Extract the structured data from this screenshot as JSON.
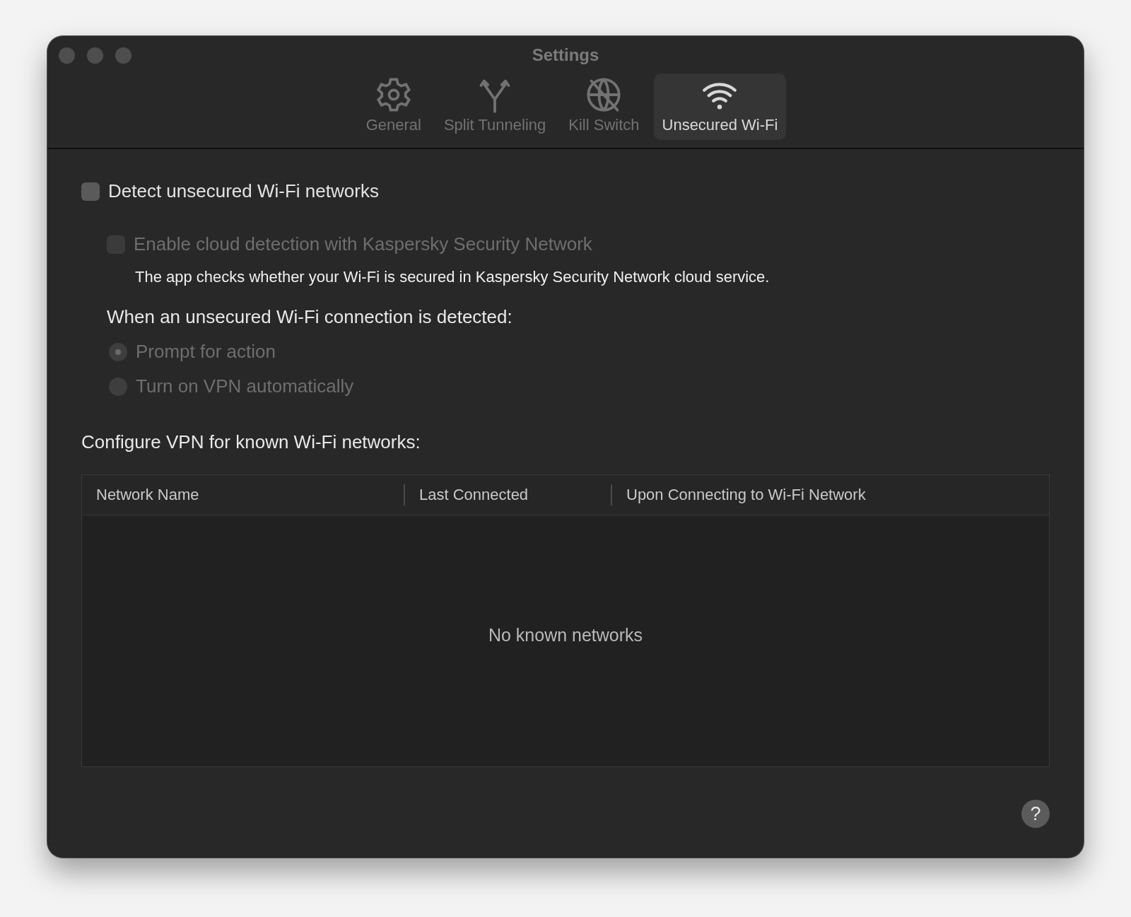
{
  "window": {
    "title": "Settings"
  },
  "tabs": [
    {
      "label": "General",
      "kind": "gear",
      "selected": false
    },
    {
      "label": "Split Tunneling",
      "kind": "split",
      "selected": false
    },
    {
      "label": "Kill Switch",
      "kind": "globe-off",
      "selected": false
    },
    {
      "label": "Unsecured Wi-Fi",
      "kind": "wifi",
      "selected": true
    }
  ],
  "detect_checkbox": {
    "label": "Detect unsecured Wi-Fi networks",
    "checked": false,
    "disabled": false
  },
  "cloud_checkbox": {
    "label": "Enable cloud detection with Kaspersky Security Network",
    "checked": false,
    "disabled": true,
    "description": "The app checks whether your Wi-Fi is secured in Kaspersky Security Network cloud service."
  },
  "action_heading": "When an unsecured Wi-Fi connection is detected:",
  "action_options": [
    {
      "label": "Prompt for action",
      "selected": true,
      "disabled": true
    },
    {
      "label": "Turn on VPN automatically",
      "selected": false,
      "disabled": true
    }
  ],
  "known_heading": "Configure VPN for known Wi-Fi networks:",
  "table": {
    "columns": [
      "Network Name",
      "Last Connected",
      "Upon Connecting to Wi-Fi Network"
    ],
    "empty_text": "No known networks"
  },
  "help_button": {
    "label": "?"
  }
}
